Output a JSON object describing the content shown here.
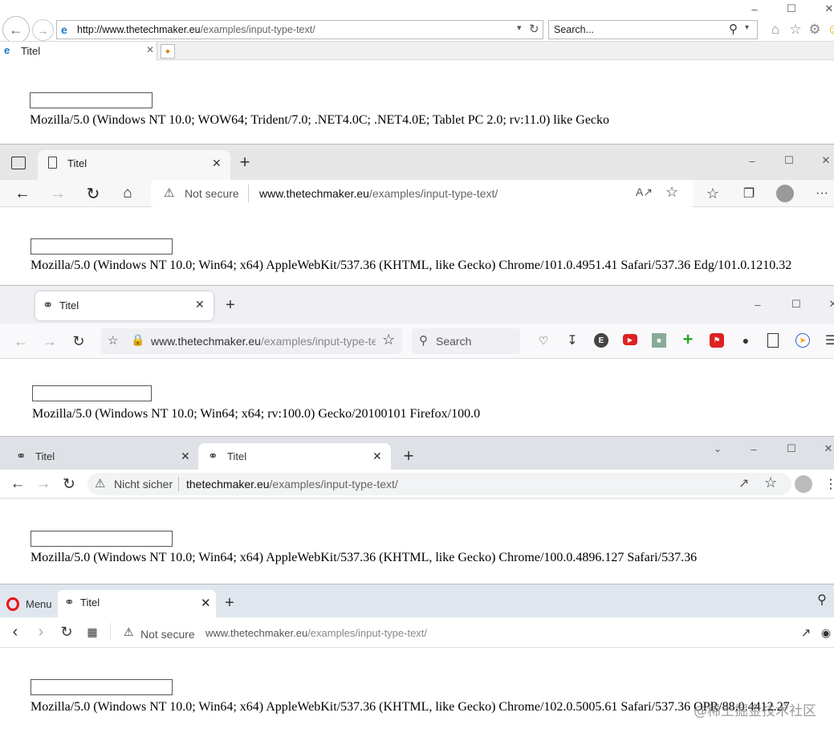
{
  "ie": {
    "url_host": "http://www.thetechmaker.eu",
    "url_path": "/examples/input-type-text/",
    "search_placeholder": "Search...",
    "tab_title": "Titel",
    "user_agent": "Mozilla/5.0 (Windows NT 10.0; WOW64; Trident/7.0; .NET4.0C; .NET4.0E; Tablet PC 2.0; rv:11.0) like Gecko"
  },
  "edge": {
    "tab_title": "Titel",
    "security_label": "Not secure",
    "url_host": "www.thetechmaker.eu",
    "url_path": "/examples/input-type-text/",
    "user_agent": "Mozilla/5.0 (Windows NT 10.0; Win64; x64) AppleWebKit/537.36 (KHTML, like Gecko) Chrome/101.0.4951.41 Safari/537.36 Edg/101.0.1210.32"
  },
  "firefox": {
    "tab_title": "Titel",
    "url_host": "www.thetechmaker.eu",
    "url_path": "/examples/input-type-te",
    "search_placeholder": "Search",
    "user_agent": "Mozilla/5.0 (Windows NT 10.0; Win64; x64; rv:100.0) Gecko/20100101 Firefox/100.0"
  },
  "chrome": {
    "tabs": [
      "Titel",
      "Titel"
    ],
    "security_label": "Nicht sicher",
    "url_host": "thetechmaker.eu",
    "url_path": "/examples/input-type-text/",
    "user_agent": "Mozilla/5.0 (Windows NT 10.0; Win64; x64) AppleWebKit/537.36 (KHTML, like Gecko) Chrome/100.0.4896.127 Safari/537.36"
  },
  "opera": {
    "menu_label": "Menu",
    "tab_title": "Titel",
    "security_label": "Not secure",
    "url_host": "www.thetechmaker.eu",
    "url_path": "/examples/input-type-text/",
    "user_agent": "Mozilla/5.0 (Windows NT 10.0; Win64; x64) AppleWebKit/537.36 (KHTML, like Gecko) Chrome/102.0.5005.61 Safari/537.36 OPR/88.0.4412.27"
  },
  "watermark": "@稀土掘金技术社区"
}
